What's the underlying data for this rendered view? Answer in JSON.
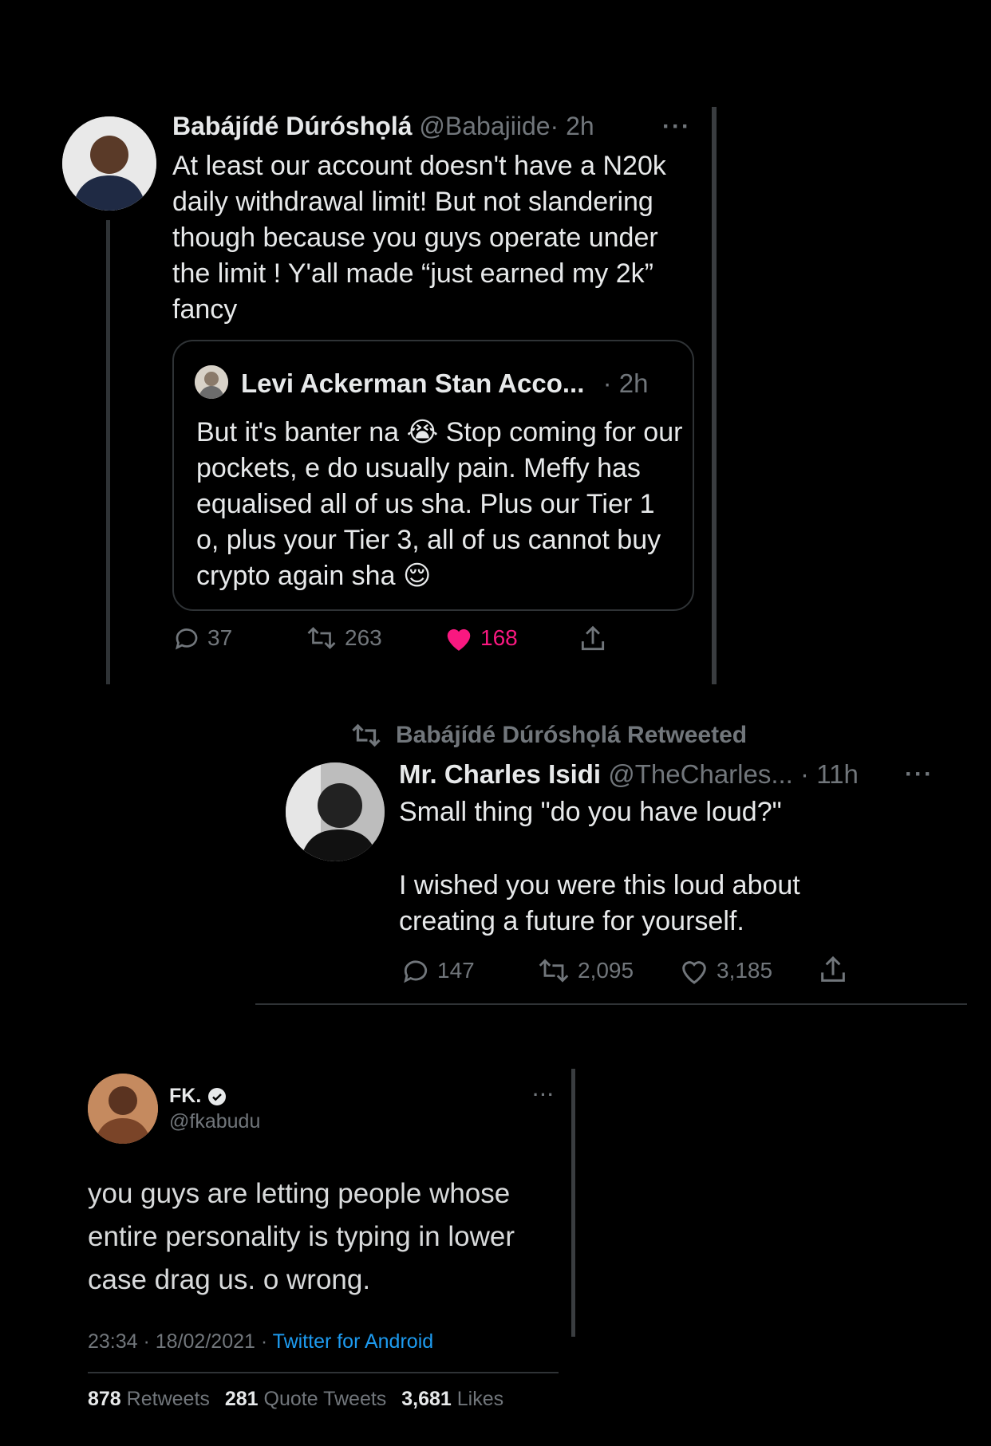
{
  "tweet1": {
    "author_name": "Babájídé Dúróshọlá",
    "handle": "@Babajiide",
    "time": "· 2h",
    "more": "···",
    "text": "At least our account doesn't have a N20k daily withdrawal limit! But not slandering though because you guys operate under the limit ! Y'all made “just earned my 2k” fancy",
    "quote": {
      "author_name": "Levi Ackerman Stan Acco...",
      "time": "· 2h",
      "text_1": "But it's banter na",
      "emoji_1": "😭",
      "text_2": "Stop coming for our pockets, e do usually pain. Meffy has equalised all of us sha. Plus our Tier 1 o, plus your Tier 3, all of us cannot buy crypto again sha",
      "emoji_2": "😌"
    },
    "replies": "37",
    "retweets": "263",
    "likes": "168"
  },
  "tweet2": {
    "retweeted_by": "Babájídé Dúróshọlá Retweeted",
    "author_name": "Mr. Charles Isidi",
    "handle": "@TheCharles...",
    "time": "· 11h",
    "more": "···",
    "text_line1": "Small thing \"do you have loud?\"",
    "text_line2": "I wished you were this loud about creating a future for yourself.",
    "replies": "147",
    "retweets": "2,095",
    "likes": "3,185"
  },
  "tweet3": {
    "author_name": "FK.",
    "handle": "@fkabudu",
    "more": "···",
    "text": "you guys are letting people whose entire personality is typing in lower case drag us. o wrong.",
    "timestamp": "23:34 · 18/02/2021 ·",
    "source": "Twitter for Android",
    "retweets_count": "878",
    "retweets_label": "Retweets",
    "quotes_count": "281",
    "quotes_label": "Quote Tweets",
    "likes_count": "3,681",
    "likes_label": "Likes"
  },
  "colors": {
    "background": "#000000",
    "like_active": "#f91880",
    "verified": "#e7e9ea",
    "link": "#1d9bf0"
  }
}
